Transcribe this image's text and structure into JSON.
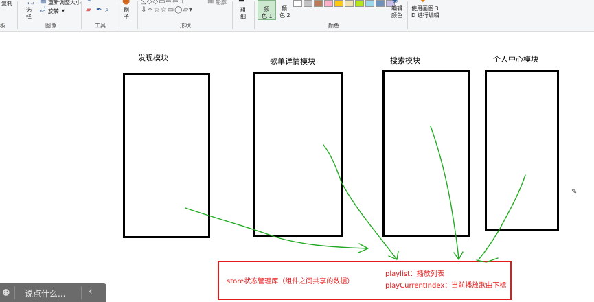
{
  "ribbon": {
    "partial_left_top": "复制",
    "partial_left_group": "板",
    "image_group": {
      "select_label": "选",
      "select_label2": "择",
      "resize_label": "重新调整大小",
      "rotate_label": "旋转",
      "label": "图像"
    },
    "tools_group": {
      "label": "工具"
    },
    "brush_group": {
      "label1": "刷",
      "label2": "子"
    },
    "shapes_group": {
      "outline_label": "轮廓",
      "label": "形状"
    },
    "size_group": {
      "label1": "粗",
      "label2": "细"
    },
    "colors_group": {
      "color1_l1": "颜",
      "color1_l2": "色 1",
      "color2_l1": "颜",
      "color2_l2": "色 2",
      "edit_l1": "编辑",
      "edit_l2": "颜色",
      "label": "颜色"
    },
    "paint3d": {
      "l1": "使用画图 3",
      "l2": "D 进行编辑"
    },
    "palette": [
      "#ffffff",
      "#c3c3c3",
      "#b97a57",
      "#ffaec9",
      "#ffc90e",
      "#efe4b0",
      "#b5e61d",
      "#99d9ea",
      "#7092be",
      "#c8bfe7"
    ]
  },
  "canvas": {
    "modules": [
      {
        "label": "发现模块"
      },
      {
        "label": "歌单详情模块"
      },
      {
        "label": "搜索模块"
      },
      {
        "label": "个人中心模块"
      }
    ],
    "store": {
      "title": "store状态管理库（组件之间共享的数据）",
      "line1": "playlist：播放列表",
      "line2": "playCurrentIndex：当前播放歌曲下标"
    }
  },
  "overlay": {
    "placeholder": "说点什么...",
    "back_glyph": "‹"
  },
  "colors": {
    "arrow": "#22aa22",
    "store_border": "#e21a1a",
    "store_text": "#e21a1a"
  }
}
